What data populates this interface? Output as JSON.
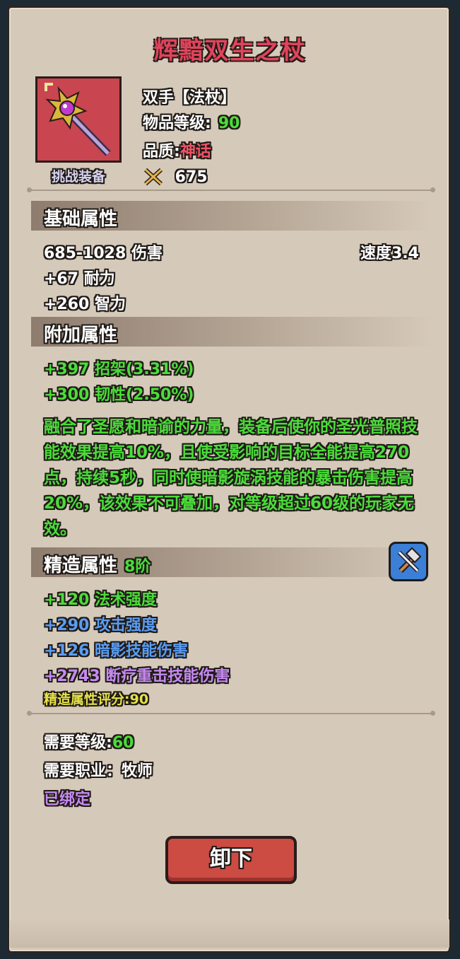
{
  "item": {
    "name": "辉黯双生之杖",
    "slot": "双手【法杖】",
    "level_label": "物品等级:",
    "level_value": "90",
    "quality_label": "品质:",
    "quality_value": "神话",
    "score": "675",
    "tag": "挑战装备"
  },
  "base": {
    "title": "基础属性",
    "damage": "685-1028 伤害",
    "speed": "速度3.4",
    "stats": [
      "+67 耐力",
      "+260 智力"
    ]
  },
  "extra": {
    "title": "附加属性",
    "stats": [
      "+397 招架(3.31%)",
      "+300 韧性(2.50%)"
    ],
    "description": "融合了圣愿和暗谕的力量，装备后使你的圣光普照技能效果提高10%，且使受影响的目标全能提高270点，持续5秒，同时使暗影旋涡技能的暴击伤害提高20%，该效果不可叠加，对等级超过60级的玩家无效。"
  },
  "forge": {
    "title": "精造属性",
    "tier": "8阶",
    "stats": [
      "+120 法术强度",
      "+290 攻击强度",
      "+126 暗影技能伤害",
      "+2743 断疗重击技能伤害"
    ],
    "score_text": "精造属性评分:90"
  },
  "requirements": {
    "level_label": "需要等级:",
    "level_value": "60",
    "class_text": "需要职业：牧师",
    "bound_text": "已绑定"
  },
  "actions": {
    "unequip": "卸下"
  },
  "icons": {
    "item": "staff-icon",
    "score": "crossed-swords-icon",
    "forge": "hammer-icon"
  },
  "colors": {
    "title": "#e0445a",
    "green": "#4bdc3a",
    "blue": "#5a9df2",
    "purple": "#c58af0",
    "yellow": "#e7e24a",
    "button": "#cc4b42"
  }
}
